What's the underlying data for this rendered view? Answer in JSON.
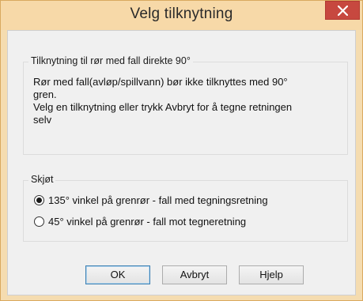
{
  "window": {
    "title": "Velg tilknytning",
    "close_symbol": "✕"
  },
  "info_group": {
    "legend": "Tilknytning til rør med fall direkte 90°",
    "line1": "Rør med fall(avløp/spillvann) bør ikke tilknyttes med 90°",
    "line2": "gren.",
    "line3": "Velg en tilknytning eller trykk Avbryt for å tegne retningen",
    "line4": "selv"
  },
  "joint_group": {
    "legend": "Skjøt",
    "options": [
      {
        "label": "135° vinkel på grenrør - fall med tegningsretning",
        "selected": true
      },
      {
        "label": "45° vinkel på grenrør - fall mot tegneretning",
        "selected": false
      }
    ]
  },
  "buttons": {
    "ok": "OK",
    "cancel": "Avbryt",
    "help": "Hjelp"
  },
  "colors": {
    "titlebar": "#f7d9a8",
    "close": "#c7483f",
    "dialog_bg": "#f0f0f0",
    "default_button_border": "#3c7fb1"
  }
}
